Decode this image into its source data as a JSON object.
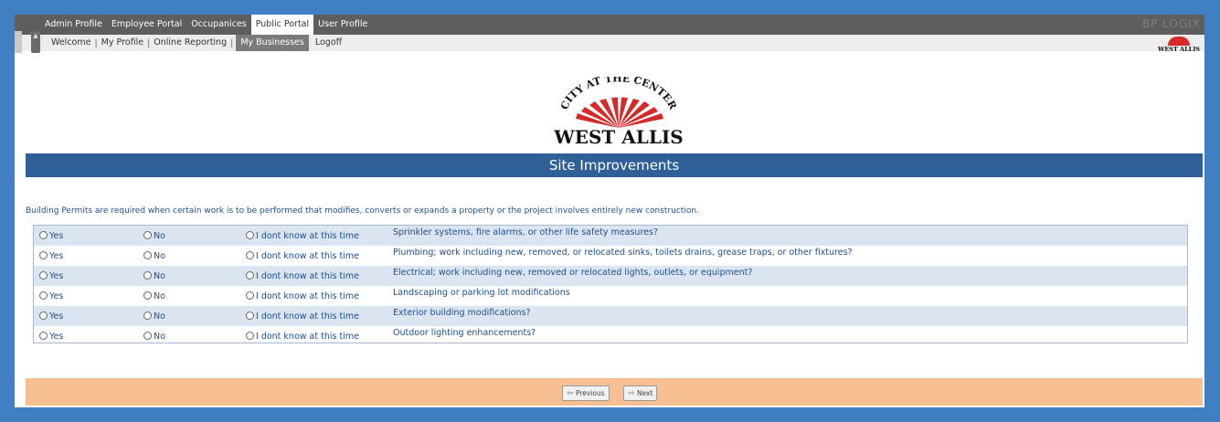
{
  "top_nav": {
    "items": [
      {
        "label": "Admin Profile",
        "active": false
      },
      {
        "label": "Employee Portal",
        "active": false
      },
      {
        "label": "Occupanices",
        "active": false
      },
      {
        "label": "Public Portal",
        "active": true
      },
      {
        "label": "User Profile",
        "active": false
      }
    ],
    "vendor_logo": "BP LOGIX"
  },
  "sub_nav": {
    "items": [
      "Welcome",
      "My Profile",
      "Online Reporting",
      "My Businesses",
      "Logoff"
    ],
    "active": "My Businesses"
  },
  "logo": {
    "arc_text": "CITY AT THE CENTER",
    "name": "WEST ALLIS",
    "corner_name": "WEST ALLIS",
    "accent": "#d42a2a"
  },
  "page": {
    "title": "Site Improvements",
    "intro": "Building Permits are required when certain work is to be performed that modifies, converts or expands a property or the project involves entirely new construction."
  },
  "options": {
    "yes": "Yes",
    "no": "No",
    "dont_know": "I dont know at this time"
  },
  "questions": [
    "Sprinkler systems, fire alarms, or other life safety measures?",
    "Plumbing; work including new, removed, or relocated sinks, toilets drains, grease traps, or other fixtures?",
    "Electrical; work including new, removed or relocated lights, outlets, or equipment?",
    "Landscaping or parking lot modifications",
    "Exterior building modifications?",
    "Outdoor lighting enhancements?"
  ],
  "footer": {
    "previous_label": "Previous",
    "next_label": "Next"
  },
  "colors": {
    "frame": "#3f7fc1",
    "title_bar": "#2e5f96",
    "footer": "#f8bf92",
    "text_blue": "#1f4e8c"
  }
}
